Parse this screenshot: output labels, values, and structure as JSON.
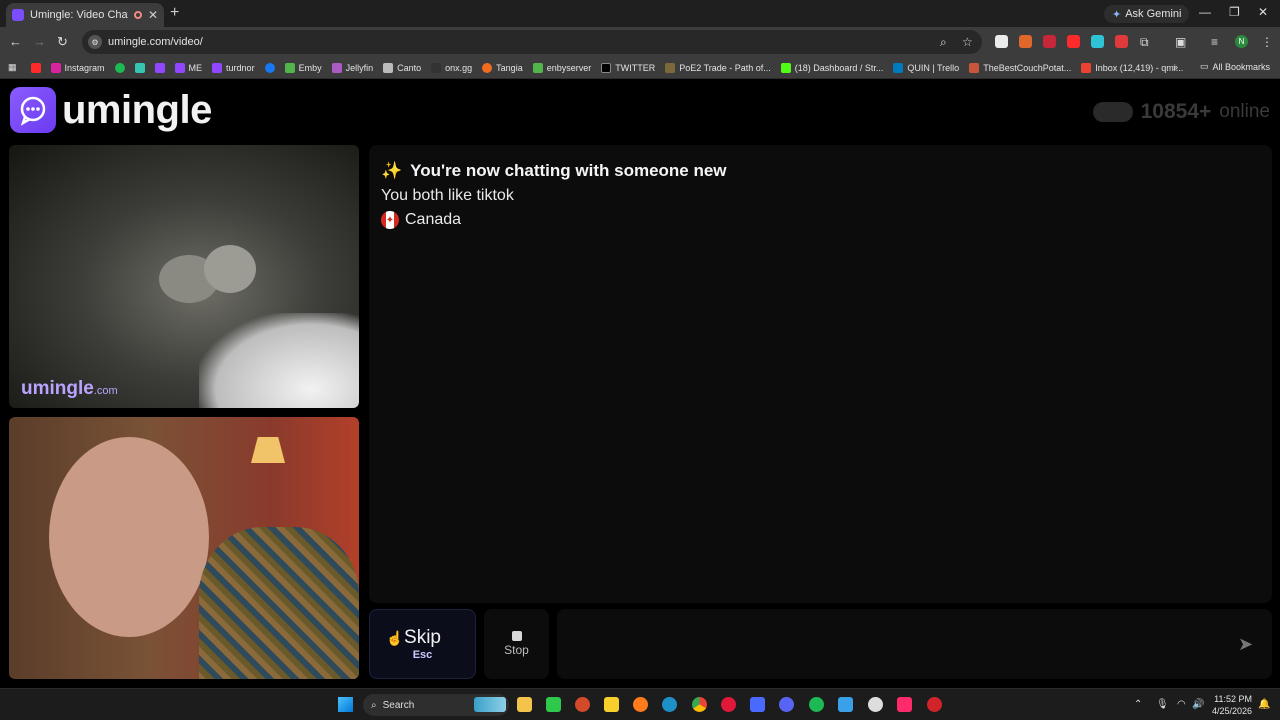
{
  "browser": {
    "tab_title": "Umingle: Video Chat with S",
    "tab_close": "✕",
    "new_tab": "+",
    "ask_gemini": "Ask Gemini",
    "url": "umingle.com/video/",
    "profile_initial": "N",
    "bookmarks": [
      "Instagram",
      "ME",
      "turdnor",
      "Emby",
      "Jellyfin",
      "Canto",
      "onx.gg",
      "Tangia",
      "enbyserver",
      "TWITTER",
      "PoE2 Trade - Path of...",
      "(18) Dashboard / Str...",
      "QUIN | Trello",
      "TheBestCouchPotat...",
      "Inbox (12,419) - qmi..."
    ],
    "all_bookmarks": "All Bookmarks"
  },
  "site": {
    "logo_text": "umingle",
    "online_count": "10854+",
    "online_label": "online",
    "watermark": "umingle",
    "watermark_suffix": ".com"
  },
  "chat": {
    "sparkle": "✨",
    "header": "You're now chatting with someone new",
    "shared_interest": "You both like tiktok",
    "country": "Canada"
  },
  "controls": {
    "skip_label": "Skip",
    "skip_key": "Esc",
    "stop_label": "Stop",
    "message_value": "",
    "send_icon": "➤"
  },
  "taskbar": {
    "search_label": "Search",
    "time": "11:52 PM",
    "date": "4/25/2026"
  }
}
